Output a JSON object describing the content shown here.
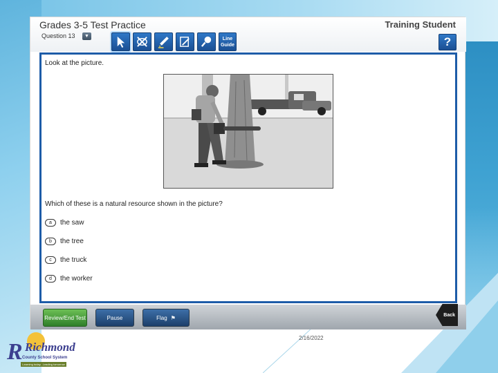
{
  "header": {
    "title": "Grades 3-5 Test Practice",
    "question_label": "Question 13",
    "student_name": "Training Student",
    "tools": [
      {
        "name": "pointer-icon"
      },
      {
        "name": "eliminator-icon"
      },
      {
        "name": "highlighter-icon"
      },
      {
        "name": "notepad-icon"
      },
      {
        "name": "magnifier-icon"
      }
    ],
    "line_guide_label": "Line Guide",
    "help_label": "?"
  },
  "question": {
    "prompt": "Look at the picture.",
    "text": "Which of these is a natural resource shown in the picture?",
    "choices": [
      {
        "letter": "a",
        "text": "the saw"
      },
      {
        "letter": "b",
        "text": "the tree"
      },
      {
        "letter": "c",
        "text": "the truck"
      },
      {
        "letter": "d",
        "text": "the worker"
      }
    ]
  },
  "footer": {
    "review_label": "Review/End Test",
    "pause_label": "Pause",
    "flag_label": "Flag",
    "back_label": "Back"
  },
  "slide": {
    "date": "2/16/2022",
    "logo_name": "Richmond",
    "logo_sub": "County School System",
    "logo_tag": "Learning today...Leading tomorrow"
  },
  "colors": {
    "accent": "#1d5ca8",
    "review_green": "#2f7f2a"
  }
}
